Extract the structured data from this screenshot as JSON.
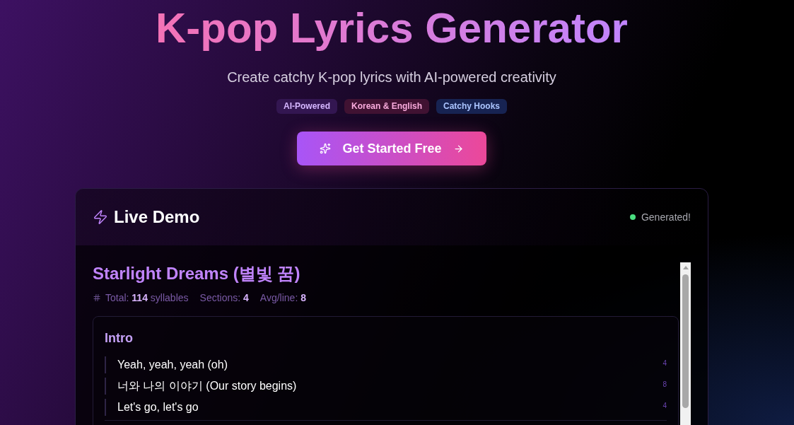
{
  "hero": {
    "title": "K-pop Lyrics Generator",
    "subtitle": "Create catchy K-pop lyrics with AI-powered creativity",
    "tags": [
      {
        "label": "AI-Powered",
        "color": "#331651"
      },
      {
        "label": "Korean & English",
        "color": "#401232"
      },
      {
        "label": "Catchy Hooks",
        "color": "#172352"
      }
    ],
    "cta": {
      "label": "Get Started Free"
    }
  },
  "demo": {
    "title": "Live Demo",
    "status": {
      "label": "Generated!",
      "color": "#4ade80"
    },
    "song": {
      "title": "Starlight Dreams (별빛 꿈)",
      "stats": [
        {
          "label": "Total:",
          "value": "114",
          "unit": "syllables"
        },
        {
          "label": "Sections:",
          "value": "4"
        },
        {
          "label": "Avg/line:",
          "value": "8"
        }
      ],
      "sections": [
        {
          "name": "Intro",
          "lines": [
            {
              "text": "Yeah, yeah, yeah (oh)",
              "syllables": "4"
            },
            {
              "text": "너와 나의 이야기 (Our story begins)",
              "syllables": "8"
            },
            {
              "text": "Let's go, let's go",
              "syllables": "4"
            }
          ]
        }
      ]
    }
  }
}
